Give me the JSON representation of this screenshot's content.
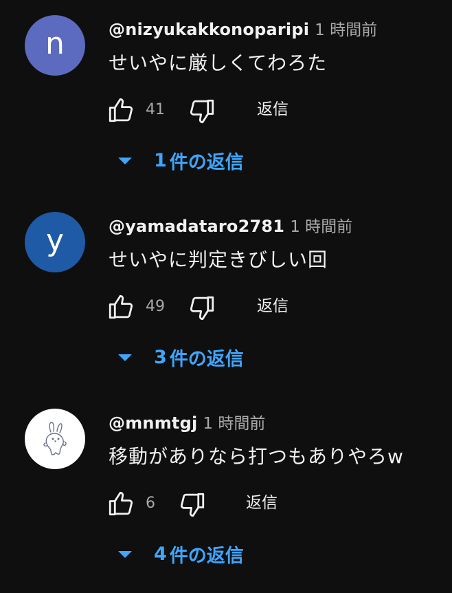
{
  "comments": [
    {
      "avatar": {
        "type": "letter",
        "letter": "n",
        "color": "#5c6bc0"
      },
      "handle": "@nizyukakkonoparipi",
      "time": "1 時間前",
      "text": "せいやに厳しくてわろた",
      "like_count": "41",
      "reply_label": "返信",
      "replies": {
        "count": "1",
        "label": "件の返信"
      }
    },
    {
      "avatar": {
        "type": "letter",
        "letter": "y",
        "color": "#1f5aa6"
      },
      "handle": "@yamadataro2781",
      "time": "1 時間前",
      "text": "せいやに判定きびしい回",
      "like_count": "49",
      "reply_label": "返信",
      "replies": {
        "count": "3",
        "label": "件の返信"
      }
    },
    {
      "avatar": {
        "type": "image",
        "description": "rabbit-sketch",
        "color": "#ffffff"
      },
      "handle": "@mnmtgj",
      "time": "1 時間前",
      "text": "移動がありなら打つもありやろw",
      "like_count": "6",
      "reply_label": "返信",
      "replies": {
        "count": "4",
        "label": "件の返信"
      }
    }
  ],
  "icons": {
    "like": "thumbs-up-icon",
    "dislike": "thumbs-down-icon",
    "expand": "caret-down-icon"
  },
  "colors": {
    "background": "#0f0f0f",
    "link": "#3ea6ff",
    "secondary_text": "#aaaaaa",
    "primary_text": "#f1f1f1"
  }
}
